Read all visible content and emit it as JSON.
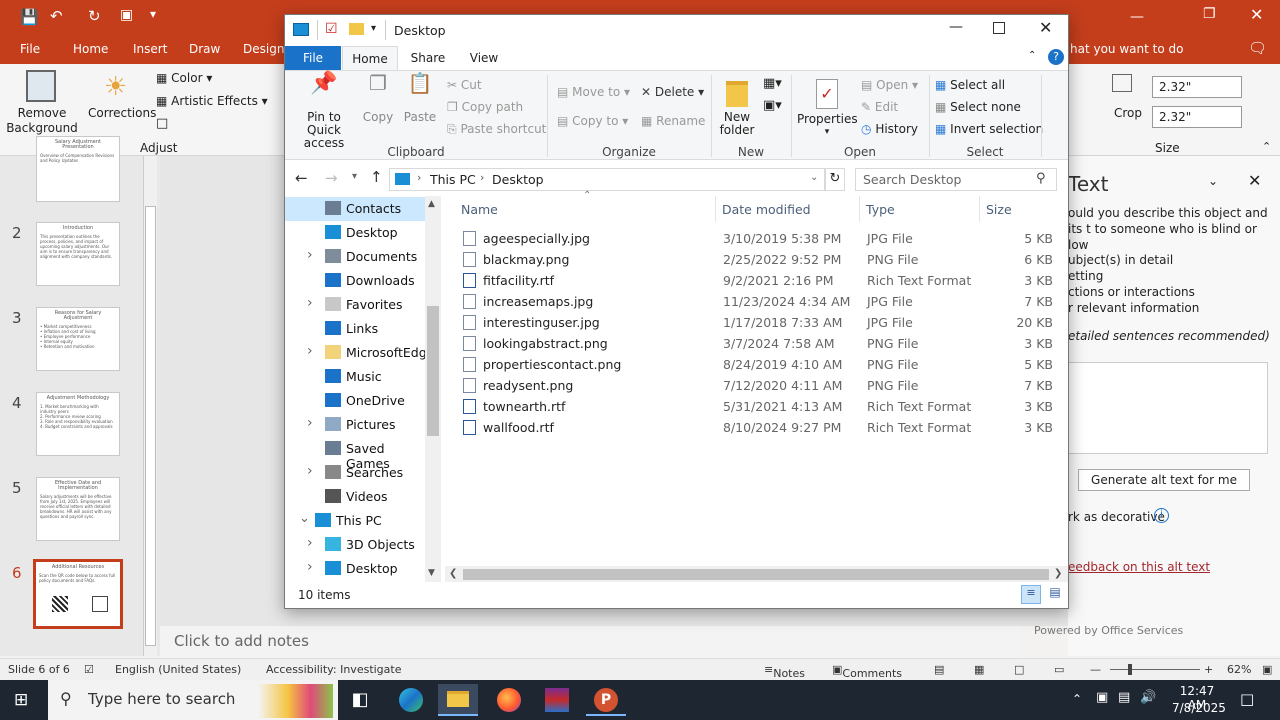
{
  "powerpoint": {
    "tabs": [
      "File",
      "Home",
      "Insert",
      "Draw",
      "Design"
    ],
    "title_hint": "hat you want to do",
    "ribbon": {
      "remove_background": "Remove Background",
      "corrections": "Corrections",
      "color": "Color",
      "artistic_effects": "Artistic Effects",
      "adjust_group": "Adjust",
      "crop": "Crop",
      "height": "2.32\"",
      "width": "2.32\"",
      "size_group": "Size"
    },
    "slides": [
      {
        "num": "",
        "title": "Salary Adjustment Presentation",
        "lines": [
          "Overview of Compensation Revisions and Policy Updates"
        ]
      },
      {
        "num": "2",
        "title": "Introduction",
        "lines": [
          "This presentation outlines the process, policies, and impact of upcoming salary adjustments. Our aim is to ensure transparency and alignment with company standards."
        ]
      },
      {
        "num": "3",
        "title": "Reasons for Salary Adjustment",
        "lines": [
          "• Market competitiveness",
          "• Inflation and cost of living",
          "• Employee performance",
          "• Internal equity",
          "• Retention and motivation"
        ]
      },
      {
        "num": "4",
        "title": "Adjustment Methodology",
        "lines": [
          "1. Market benchmarking with industry peers",
          "2. Performance review scoring",
          "3. Role and responsibility evaluation",
          "4. Budget constraints and approvals"
        ]
      },
      {
        "num": "5",
        "title": "Effective Date and Implementation",
        "lines": [
          "Salary adjustments will be effective from July 1st, 2025. Employees will receive official letters with detailed breakdowns. HR will assist with any questions and payroll sync."
        ]
      },
      {
        "num": "6",
        "title": "Additional Resources",
        "lines": [
          "Scan the QR code below to access full policy documents and FAQs."
        ]
      }
    ],
    "notes_placeholder": "Click to add notes",
    "alt_text": {
      "title": "Text",
      "prompt": "ould you describe this object and its t to someone who is blind or low",
      "items": [
        "ubject(s) in detail",
        "etting",
        "ctions or interactions",
        "r relevant information"
      ],
      "hint": "etailed sentences recommended)",
      "generate_button": "Generate alt text for me",
      "decorative": "rk as decorative",
      "feedback": "eedback on this alt text",
      "powered": "Powered by Office Services"
    },
    "status": {
      "slide": "Slide 6 of 6",
      "language": "English (United States)",
      "accessibility": "Accessibility: Investigate",
      "notes": "Notes",
      "comments": "Comments",
      "zoom": "62%"
    }
  },
  "explorer": {
    "title": "Desktop",
    "tabs": [
      "File",
      "Home",
      "Share",
      "View"
    ],
    "ribbon": {
      "pin": "Pin to Quick access",
      "copy": "Copy",
      "paste": "Paste",
      "cut": "Cut",
      "copy_path": "Copy path",
      "paste_shortcut": "Paste shortcut",
      "clipboard": "Clipboard",
      "move_to": "Move to",
      "copy_to": "Copy to",
      "delete": "Delete",
      "rename": "Rename",
      "organize": "Organize",
      "new_folder": "New folder",
      "new": "New",
      "properties": "Properties",
      "open": "Open",
      "edit": "Edit",
      "history": "History",
      "open_group": "Open",
      "select_all": "Select all",
      "select_none": "Select none",
      "invert_selection": "Invert selection",
      "select_group": "Select"
    },
    "breadcrumb": [
      "This PC",
      "Desktop"
    ],
    "search_placeholder": "Search Desktop",
    "nav": [
      {
        "label": "Contacts",
        "expand": false,
        "indent": 1,
        "selected": true
      },
      {
        "label": "Desktop",
        "expand": false,
        "indent": 1
      },
      {
        "label": "Documents",
        "expand": true,
        "indent": 1
      },
      {
        "label": "Downloads",
        "expand": false,
        "indent": 1
      },
      {
        "label": "Favorites",
        "expand": true,
        "indent": 1
      },
      {
        "label": "Links",
        "expand": false,
        "indent": 1
      },
      {
        "label": "MicrosoftEdge",
        "expand": true,
        "indent": 1
      },
      {
        "label": "Music",
        "expand": false,
        "indent": 1
      },
      {
        "label": "OneDrive",
        "expand": false,
        "indent": 1
      },
      {
        "label": "Pictures",
        "expand": true,
        "indent": 1
      },
      {
        "label": "Saved Games",
        "expand": false,
        "indent": 1
      },
      {
        "label": "Searches",
        "expand": true,
        "indent": 1
      },
      {
        "label": "Videos",
        "expand": false,
        "indent": 1
      },
      {
        "label": "This PC",
        "expand": "open",
        "indent": 0
      },
      {
        "label": "3D Objects",
        "expand": true,
        "indent": 1
      },
      {
        "label": "Desktop",
        "expand": true,
        "indent": 1
      }
    ],
    "columns": [
      "Name",
      "Date modified",
      "Type",
      "Size"
    ],
    "files": [
      {
        "name": "ageespecially.jpg",
        "date": "3/10/2019 5:38 PM",
        "type": "JPG File",
        "size": "5 KB"
      },
      {
        "name": "blackmay.png",
        "date": "2/25/2022 9:52 PM",
        "type": "PNG File",
        "size": "6 KB"
      },
      {
        "name": "fitfacility.rtf",
        "date": "9/2/2021 2:16 PM",
        "type": "Rich Text Format",
        "size": "3 KB"
      },
      {
        "name": "increasemaps.jpg",
        "date": "11/23/2024 4:34 AM",
        "type": "JPG File",
        "size": "7 KB"
      },
      {
        "name": "interestinguser.jpg",
        "date": "1/17/2018 7:33 AM",
        "type": "JPG File",
        "size": "20 KB"
      },
      {
        "name": "lookingabstract.png",
        "date": "3/7/2024 7:58 AM",
        "type": "PNG File",
        "size": "3 KB"
      },
      {
        "name": "propertiescontact.png",
        "date": "8/24/2019 4:10 AM",
        "type": "PNG File",
        "size": "5 KB"
      },
      {
        "name": "readysent.png",
        "date": "7/12/2020 4:11 AM",
        "type": "PNG File",
        "size": "7 KB"
      },
      {
        "name": "townearth.rtf",
        "date": "5/31/2021 4:13 AM",
        "type": "Rich Text Format",
        "size": "3 KB"
      },
      {
        "name": "wallfood.rtf",
        "date": "8/10/2024 9:27 PM",
        "type": "Rich Text Format",
        "size": "3 KB"
      }
    ],
    "item_count": "10 items"
  },
  "taskbar": {
    "search_placeholder": "Type here to search",
    "time": "12:47 AM",
    "date": "7/8/2025"
  },
  "colors": {
    "ppt_accent": "#c43e1c",
    "explorer_accent": "#1a73c9",
    "taskbar": "#1e2632"
  }
}
